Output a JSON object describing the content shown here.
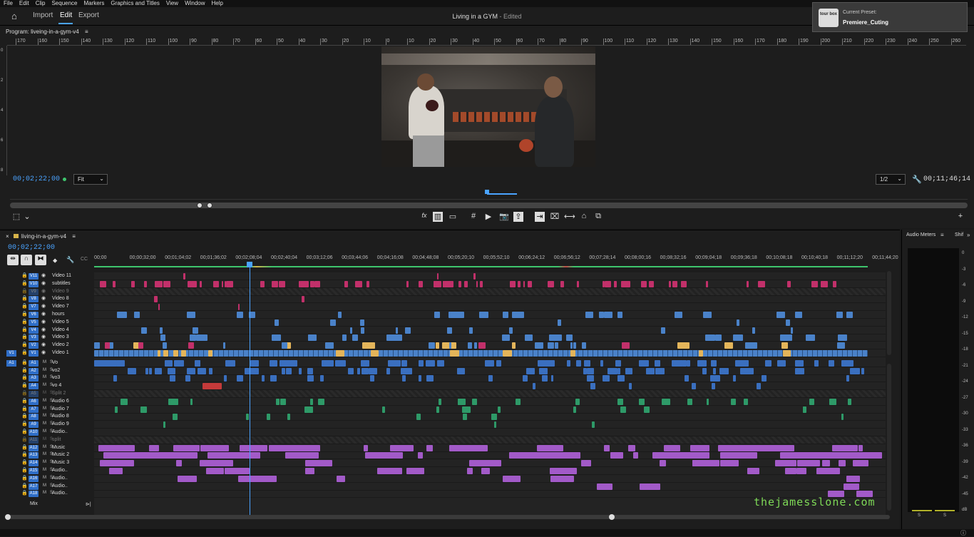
{
  "menu": [
    "File",
    "Edit",
    "Clip",
    "Sequence",
    "Markers",
    "Graphics and Titles",
    "View",
    "Window",
    "Help"
  ],
  "workspaces": {
    "import": "Import",
    "edit": "Edit",
    "export": "Export"
  },
  "document": {
    "title": "Living in a GYM",
    "status": " - Edited"
  },
  "preset": {
    "label": "Current Preset:",
    "name": "Premiere_Cuting",
    "logo": "tour box"
  },
  "program": {
    "tab": "Program: liveing-in-a-gym-v4",
    "ruler_labels": [
      "170",
      "160",
      "150",
      "140",
      "130",
      "120",
      "110",
      "100",
      "90",
      "80",
      "70",
      "60",
      "50",
      "40",
      "30",
      "20",
      "10",
      "0",
      "10",
      "20",
      "30",
      "40",
      "50",
      "60",
      "70",
      "80",
      "90",
      "100",
      "110",
      "120",
      "130",
      "140",
      "150",
      "160",
      "170",
      "180",
      "190",
      "200",
      "210",
      "220",
      "230",
      "240",
      "250",
      "260",
      "270"
    ],
    "timecode": "00;02;22;00",
    "fit": "Fit",
    "resolution": "1/2",
    "duration": "00;11;46;14"
  },
  "timeline": {
    "tab": "living-in-a-gym-v4",
    "timecode": "00;02;22;00",
    "ruler_labels": [
      "00;00",
      "00;00;32;00",
      "00;01;04;02",
      "00;01;36;02",
      "00;02;08;04",
      "00;02;40;04",
      "00;03;12;06",
      "00;03;44;06",
      "00;04;16;08",
      "00;04;48;08",
      "00;05;20;10",
      "00;05;52;10",
      "00;06;24;12",
      "00;06;56;12",
      "00;07;28;14",
      "00;08;00;16",
      "00;08;32;16",
      "00;09;04;18",
      "00;09;36;18",
      "00;10;08;18",
      "00;10;40;18",
      "00;11;12;20",
      "00;11;44;20"
    ],
    "video_tracks": [
      {
        "id": "V11",
        "name": "Video 11"
      },
      {
        "id": "V10",
        "name": "subtitles"
      },
      {
        "id": "V9",
        "name": "Video 9",
        "off": true
      },
      {
        "id": "V8",
        "name": "Video 8"
      },
      {
        "id": "V7",
        "name": "Video 7"
      },
      {
        "id": "V6",
        "name": "hours"
      },
      {
        "id": "V5",
        "name": "Video 5"
      },
      {
        "id": "V4",
        "name": "Video 4"
      },
      {
        "id": "V3",
        "name": "Video 3"
      },
      {
        "id": "V2",
        "name": "Video 2"
      },
      {
        "id": "V1",
        "name": "Video 1",
        "src": "V1"
      }
    ],
    "audio_tracks": [
      {
        "id": "A1",
        "name": "Vo",
        "src": "A1"
      },
      {
        "id": "A2",
        "name": "vo2"
      },
      {
        "id": "A3",
        "name": "vo3"
      },
      {
        "id": "A4",
        "name": "vo 4"
      },
      {
        "id": "A5",
        "name": "Split 2",
        "off": true
      },
      {
        "id": "A6",
        "name": "Audio 6"
      },
      {
        "id": "A7",
        "name": "Audio 7"
      },
      {
        "id": "A8",
        "name": "Audio 8"
      },
      {
        "id": "A9",
        "name": "Audio 9"
      },
      {
        "id": "A10",
        "name": "Audio.."
      },
      {
        "id": "A11",
        "name": "split",
        "off": true
      },
      {
        "id": "A12",
        "name": "Music"
      },
      {
        "id": "A13",
        "name": "Music 2"
      },
      {
        "id": "A14",
        "name": "Music 3"
      },
      {
        "id": "A15",
        "name": "Audio.."
      },
      {
        "id": "A16",
        "name": "Audio.."
      },
      {
        "id": "A17",
        "name": "Audio.."
      },
      {
        "id": "A18",
        "name": "Audio.."
      }
    ],
    "mix": "Mix",
    "watermark": "thejamesslone.com"
  },
  "meters": {
    "title": "Audio Meters",
    "shift": "Shif",
    "scale": [
      "0",
      "-3",
      "-6",
      "-9",
      "-12",
      "-15",
      "-18",
      "-21",
      "-24",
      "-27",
      "-30",
      "-33",
      "-36",
      "-39",
      "-42",
      "-45",
      "dB"
    ],
    "solo": [
      "S",
      "S"
    ]
  },
  "colors": {
    "accent": "#4aa3ff",
    "video": "#4a82c9",
    "subtitle": "#c2306a",
    "audio_vo": "#3a6fbf",
    "audio_sfx": "#2e9a68",
    "music": "#a25ac8",
    "adjust": "#e4b55a"
  }
}
